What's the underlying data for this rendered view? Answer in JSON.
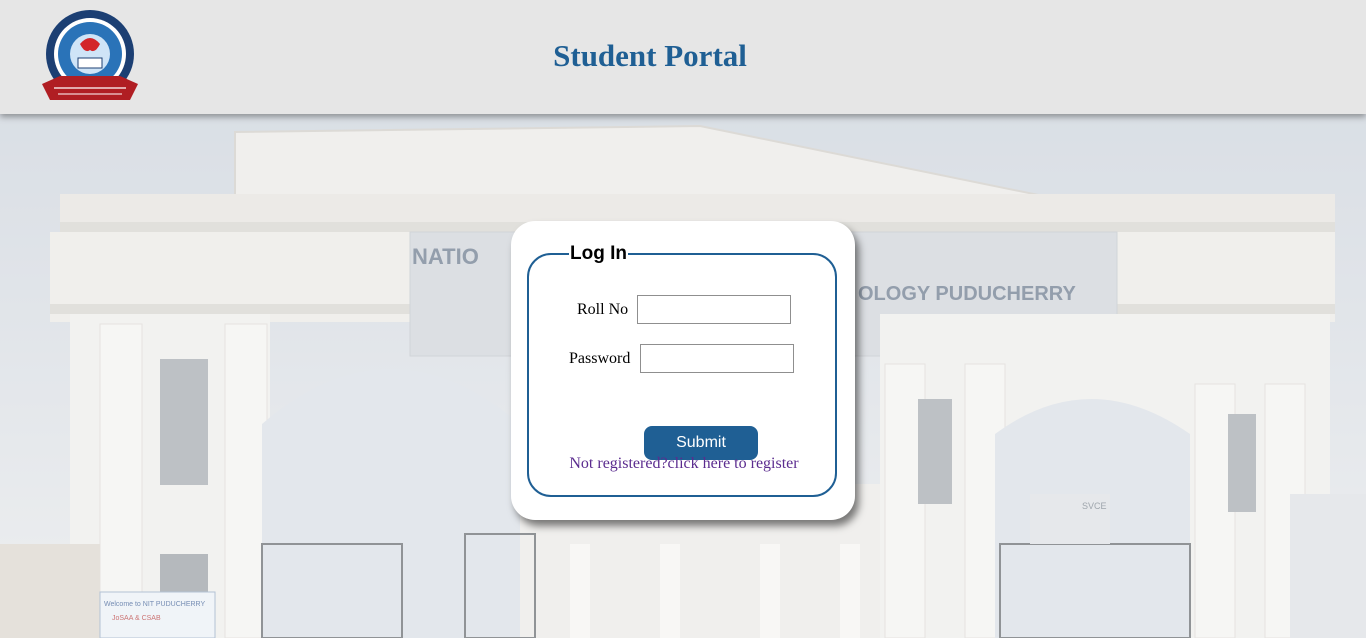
{
  "header": {
    "title": "Student Portal",
    "logo_icon": "nit-puducherry-logo-icon"
  },
  "background": {
    "gate_sign_left": "NATIO",
    "gate_sign_right": "OLOGY PUDUCHERRY",
    "banner_text": "Welcome to NIT PUDUCHERRY",
    "banner_text2": "JoSAA & CSAB",
    "building_sign": "SVCE"
  },
  "login": {
    "legend": "Log In",
    "roll_label": "Roll No",
    "roll_value": "",
    "password_label": "Password",
    "password_value": "",
    "submit_label": "Submit",
    "register_link": "Not registered?click here to register"
  },
  "colors": {
    "accent": "#1f5f94",
    "header_bg": "#e6e6e6",
    "link": "#5b2c8f"
  }
}
